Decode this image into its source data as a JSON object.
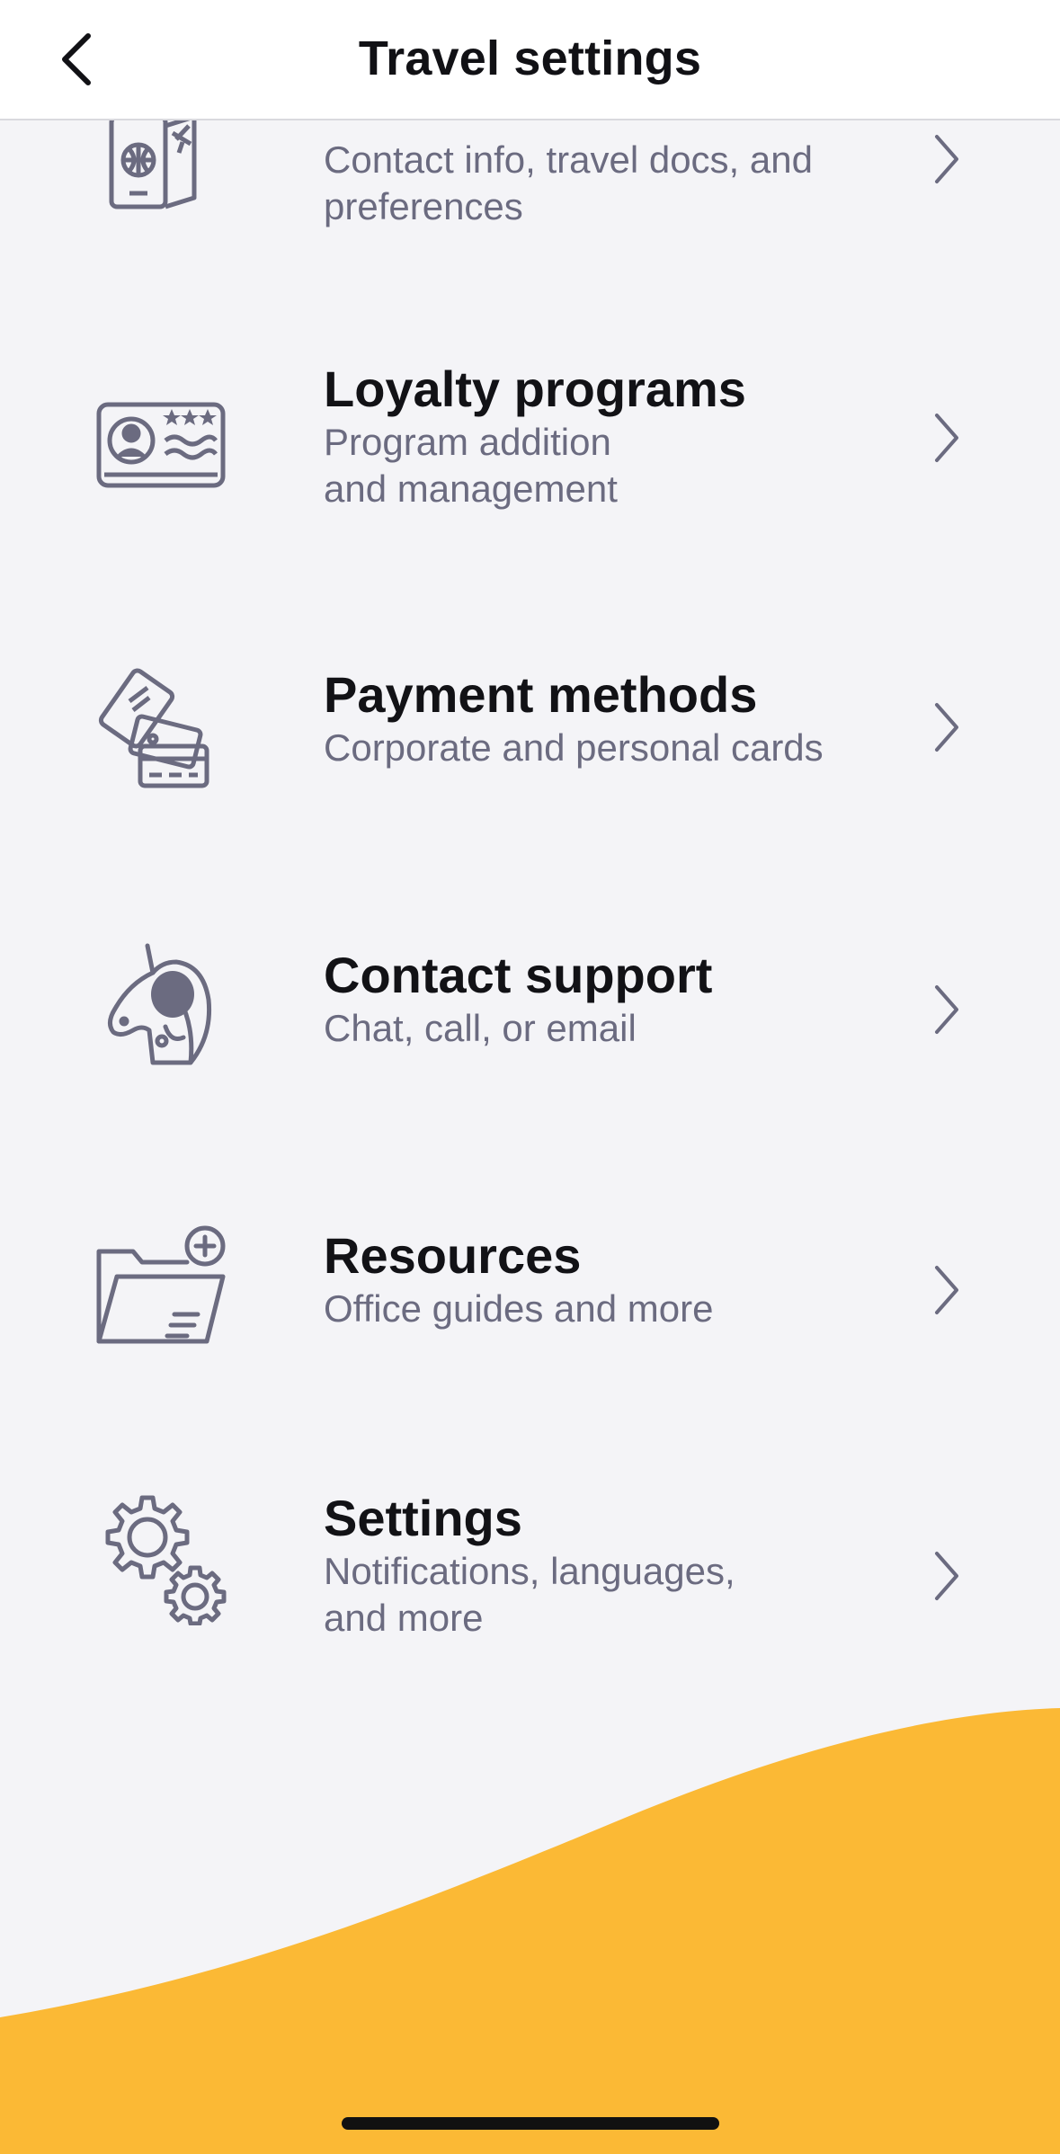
{
  "header": {
    "title": "Travel settings",
    "back_icon": "chevron-left-icon"
  },
  "items": [
    {
      "id": "profile",
      "icon": "passport-icon",
      "title": "",
      "subtitle_lines": [
        "Contact info, travel docs, and",
        "preferences"
      ]
    },
    {
      "id": "loyalty",
      "icon": "loyalty-card-icon",
      "title": "Loyalty programs",
      "subtitle_lines": [
        "Program addition",
        "and management"
      ]
    },
    {
      "id": "payment",
      "icon": "payment-cards-icon",
      "title": "Payment methods",
      "subtitle_lines": [
        "Corporate and personal cards"
      ]
    },
    {
      "id": "support",
      "icon": "unicorn-headset-icon",
      "title": "Contact support",
      "subtitle_lines": [
        "Chat, call, or email"
      ]
    },
    {
      "id": "resources",
      "icon": "folder-plus-icon",
      "title": "Resources",
      "subtitle_lines": [
        "Office guides and more"
      ]
    },
    {
      "id": "settings",
      "icon": "gears-icon",
      "title": "Settings",
      "subtitle_lines": [
        "Notifications, languages,",
        "and more"
      ]
    }
  ],
  "colors": {
    "background": "#f4f4f7",
    "header": "#ffffff",
    "title_text": "#121216",
    "subtitle_text": "#6b6b80",
    "icon_stroke": "#6b6b80",
    "accent_wave": "#fbb935"
  }
}
